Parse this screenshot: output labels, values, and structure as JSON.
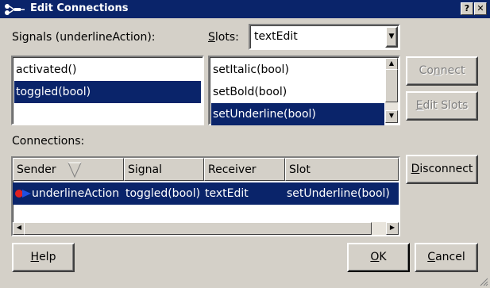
{
  "window": {
    "title": "Edit Connections",
    "help_btn": "?",
    "close_btn": "✕"
  },
  "signals": {
    "label": "Signals (underlineAction):",
    "items": [
      {
        "label": "activated()"
      },
      {
        "label": "toggled(bool)"
      }
    ]
  },
  "slots": {
    "label_first": "S",
    "label_rest": "lots:",
    "selected_value": "textEdit",
    "items": [
      {
        "label": "setItalic(bool)"
      },
      {
        "label": "setBold(bool)"
      },
      {
        "label": "setUnderline(bool)"
      }
    ]
  },
  "buttons": {
    "connect_pre": "Co",
    "connect_u": "n",
    "connect_post": "nect",
    "edit_u": "E",
    "edit_post": "dit Slots",
    "disconnect_u": "D",
    "disconnect_post": "isconnect",
    "help_u": "H",
    "help_post": "elp",
    "ok_u": "O",
    "ok_post": "K",
    "cancel_u": "C",
    "cancel_post": "ancel"
  },
  "connections": {
    "label": "Connections:",
    "columns": [
      "Sender",
      "Signal",
      "Receiver",
      "Slot"
    ],
    "rows": [
      {
        "sender": "underlineAction",
        "signal": "toggled(bool)",
        "receiver": "textEdit",
        "slot": "setUnderline(bool)"
      }
    ]
  },
  "colors": {
    "selection": "#0a246a",
    "face": "#d4d0c8"
  }
}
